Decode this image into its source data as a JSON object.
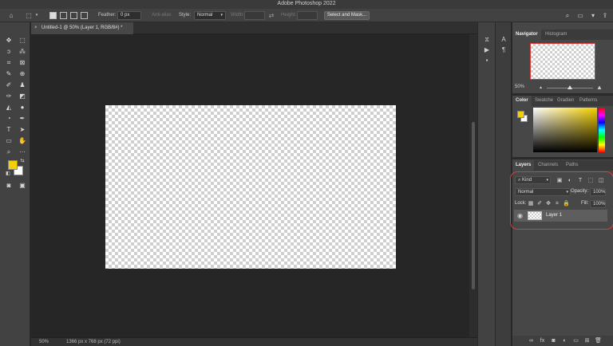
{
  "app": {
    "title": "Adobe Photoshop 2022"
  },
  "options_bar": {
    "feather_label": "Feather:",
    "feather_value": "0 px",
    "anti_alias_label": "Anti-alias",
    "style_label": "Style:",
    "style_value": "Normal",
    "width_label": "Width:",
    "height_label": "Height:",
    "select_mask_label": "Select and Mask..."
  },
  "document": {
    "tab_title": "Untitled-1 @ 50% (Layer 1, RGB/8#) *",
    "zoom": "50%",
    "info": "1366 px x 768 px (72 ppi)"
  },
  "navigator": {
    "tabs": [
      "Navigator",
      "Histogram"
    ],
    "zoom": "50%"
  },
  "color": {
    "tabs": [
      "Color",
      "Swatche",
      "Gradien",
      "Patterns"
    ],
    "foreground": "#f5d000",
    "background": "#ffffff"
  },
  "layers": {
    "tabs": [
      "Layers",
      "Channels",
      "Paths"
    ],
    "filter_label": "Kind",
    "blend_mode": "Normal",
    "opacity_label": "Opacity:",
    "opacity_value": "100%",
    "lock_label": "Lock:",
    "fill_label": "Fill:",
    "fill_value": "100%",
    "items": [
      {
        "name": "Layer 1"
      }
    ]
  },
  "colors": {
    "accent_highlight": "#e03a3a"
  }
}
